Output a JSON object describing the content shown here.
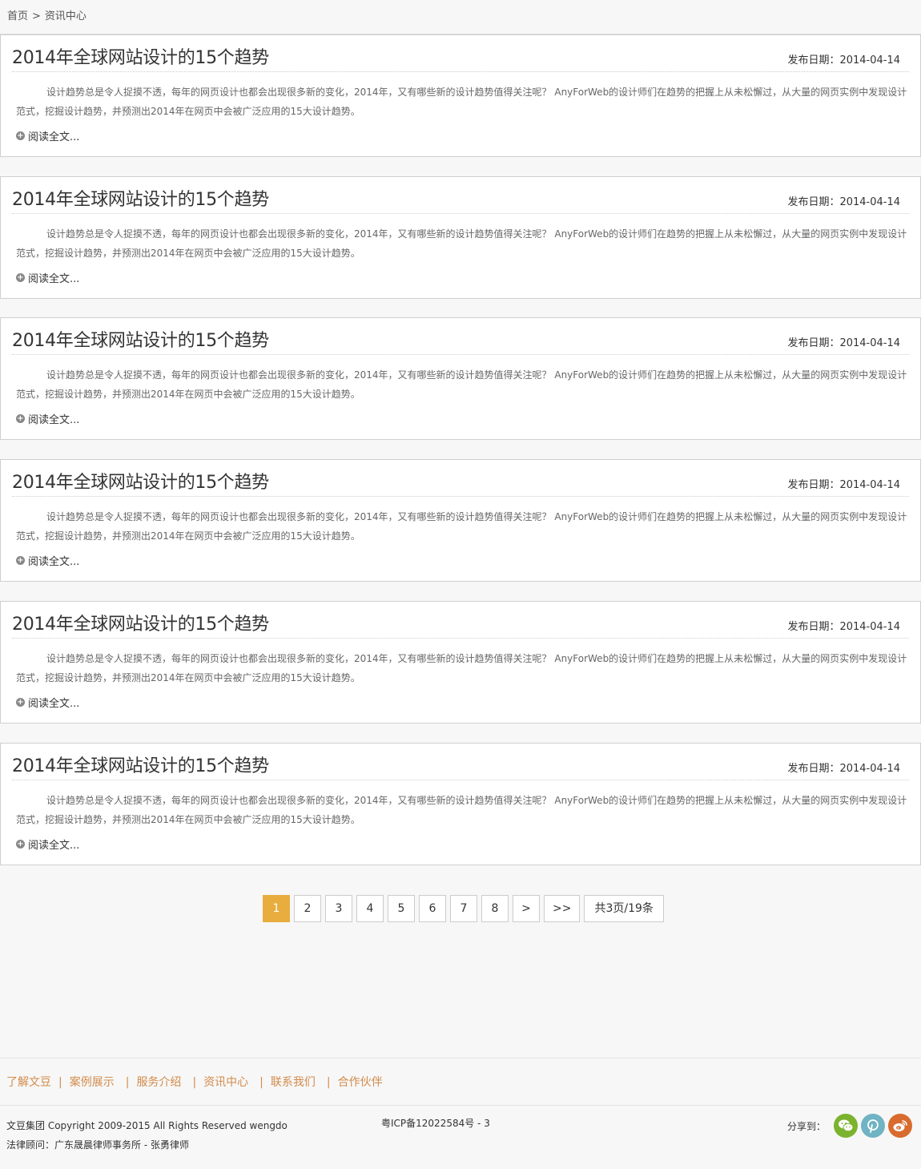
{
  "breadcrumb": {
    "home": "首页",
    "separator": ">",
    "current": "资讯中心"
  },
  "articles": [
    {
      "title": "2014年全球网站设计的15个趋势",
      "date": "发布日期：2014-04-14",
      "summary": "设计趋势总是令人捉摸不透，每年的网页设计也都会出现很多新的变化，2014年，又有哪些新的设计趋势值得关注呢？ AnyForWeb的设计师们在趋势的把握上从未松懈过，从大量的网页实例中发现设计范式，挖掘设计趋势，并预测出2014年在网页中会被广泛应用的15大设计趋势。",
      "more": "阅读全文..."
    },
    {
      "title": "2014年全球网站设计的15个趋势",
      "date": "发布日期：2014-04-14",
      "summary": "设计趋势总是令人捉摸不透，每年的网页设计也都会出现很多新的变化，2014年，又有哪些新的设计趋势值得关注呢？ AnyForWeb的设计师们在趋势的把握上从未松懈过，从大量的网页实例中发现设计范式，挖掘设计趋势，并预测出2014年在网页中会被广泛应用的15大设计趋势。",
      "more": "阅读全文..."
    },
    {
      "title": "2014年全球网站设计的15个趋势",
      "date": "发布日期：2014-04-14",
      "summary": "设计趋势总是令人捉摸不透，每年的网页设计也都会出现很多新的变化，2014年，又有哪些新的设计趋势值得关注呢？ AnyForWeb的设计师们在趋势的把握上从未松懈过，从大量的网页实例中发现设计范式，挖掘设计趋势，并预测出2014年在网页中会被广泛应用的15大设计趋势。",
      "more": "阅读全文..."
    },
    {
      "title": "2014年全球网站设计的15个趋势",
      "date": "发布日期：2014-04-14",
      "summary": "设计趋势总是令人捉摸不透，每年的网页设计也都会出现很多新的变化，2014年，又有哪些新的设计趋势值得关注呢？ AnyForWeb的设计师们在趋势的把握上从未松懈过，从大量的网页实例中发现设计范式，挖掘设计趋势，并预测出2014年在网页中会被广泛应用的15大设计趋势。",
      "more": "阅读全文..."
    },
    {
      "title": "2014年全球网站设计的15个趋势",
      "date": "发布日期：2014-04-14",
      "summary": "设计趋势总是令人捉摸不透，每年的网页设计也都会出现很多新的变化，2014年，又有哪些新的设计趋势值得关注呢？ AnyForWeb的设计师们在趋势的把握上从未松懈过，从大量的网页实例中发现设计范式，挖掘设计趋势，并预测出2014年在网页中会被广泛应用的15大设计趋势。",
      "more": "阅读全文..."
    },
    {
      "title": "2014年全球网站设计的15个趋势",
      "date": "发布日期：2014-04-14",
      "summary": "设计趋势总是令人捉摸不透，每年的网页设计也都会出现很多新的变化，2014年，又有哪些新的设计趋势值得关注呢？ AnyForWeb的设计师们在趋势的把握上从未松懈过，从大量的网页实例中发现设计范式，挖掘设计趋势，并预测出2014年在网页中会被广泛应用的15大设计趋势。",
      "more": "阅读全文..."
    }
  ],
  "pagination": {
    "pages": [
      "1",
      "2",
      "3",
      "4",
      "5",
      "6",
      "7",
      "8"
    ],
    "current": "1",
    "next": ">",
    "last": ">>",
    "total": "共3页/19条"
  },
  "footer": {
    "nav": [
      "了解文豆",
      "案例展示",
      "服务介绍",
      "资讯中心",
      "联系我们",
      "合作伙伴"
    ],
    "nav_divider": "|",
    "copyright": "文豆集团 Copyright 2009-2015 All Rights Reserved wengdo",
    "legal": "法律顾问：广东晟晨律师事务所 - 张勇律师",
    "icp": "粤ICP备12022584号 - 3",
    "share_label": "分享到：",
    "share_icons": [
      {
        "name": "wechat-icon",
        "color": "#7bb32e"
      },
      {
        "name": "pinterest-icon",
        "color": "#6fb3c4"
      },
      {
        "name": "weibo-icon",
        "color": "#d86b2d"
      }
    ]
  },
  "colors": {
    "accent": "#e8ad3e",
    "footer_link": "#d28b4b"
  }
}
